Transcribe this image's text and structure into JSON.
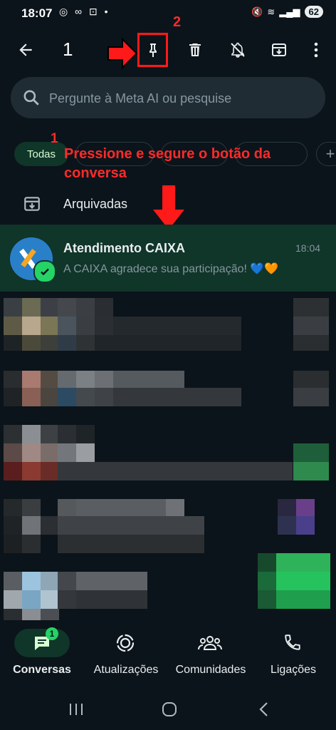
{
  "status": {
    "time": "18:07",
    "battery": "62"
  },
  "actionbar": {
    "selected_count": "1"
  },
  "search": {
    "placeholder": "Pergunte à Meta AI ou pesquise"
  },
  "filters": {
    "all": "Todas"
  },
  "annotations": {
    "step1_number": "1",
    "step1_text_line1": "Pressione e segure o botão da",
    "step1_text_line2": "conversa",
    "step2_number": "2"
  },
  "archived": {
    "label": "Arquivadas"
  },
  "chat": {
    "name": "Atendimento CAIXA",
    "time": "18:04",
    "message": "A CAIXA agradece sua participação! 💙🧡"
  },
  "bottom_nav": {
    "chats": "Conversas",
    "chats_badge": "1",
    "updates": "Atualizações",
    "communities": "Comunidades",
    "calls": "Ligações"
  },
  "colors": {
    "background": "#0b141a",
    "accent": "#25d366",
    "selected_row": "#103529",
    "annotation": "#ff2a2a"
  },
  "icons": [
    "back-arrow-icon",
    "pin-icon",
    "delete-icon",
    "mute-icon",
    "archive-icon",
    "more-icon",
    "search-icon",
    "archive-box-icon",
    "chat-icon",
    "updates-icon",
    "communities-icon",
    "call-icon"
  ]
}
